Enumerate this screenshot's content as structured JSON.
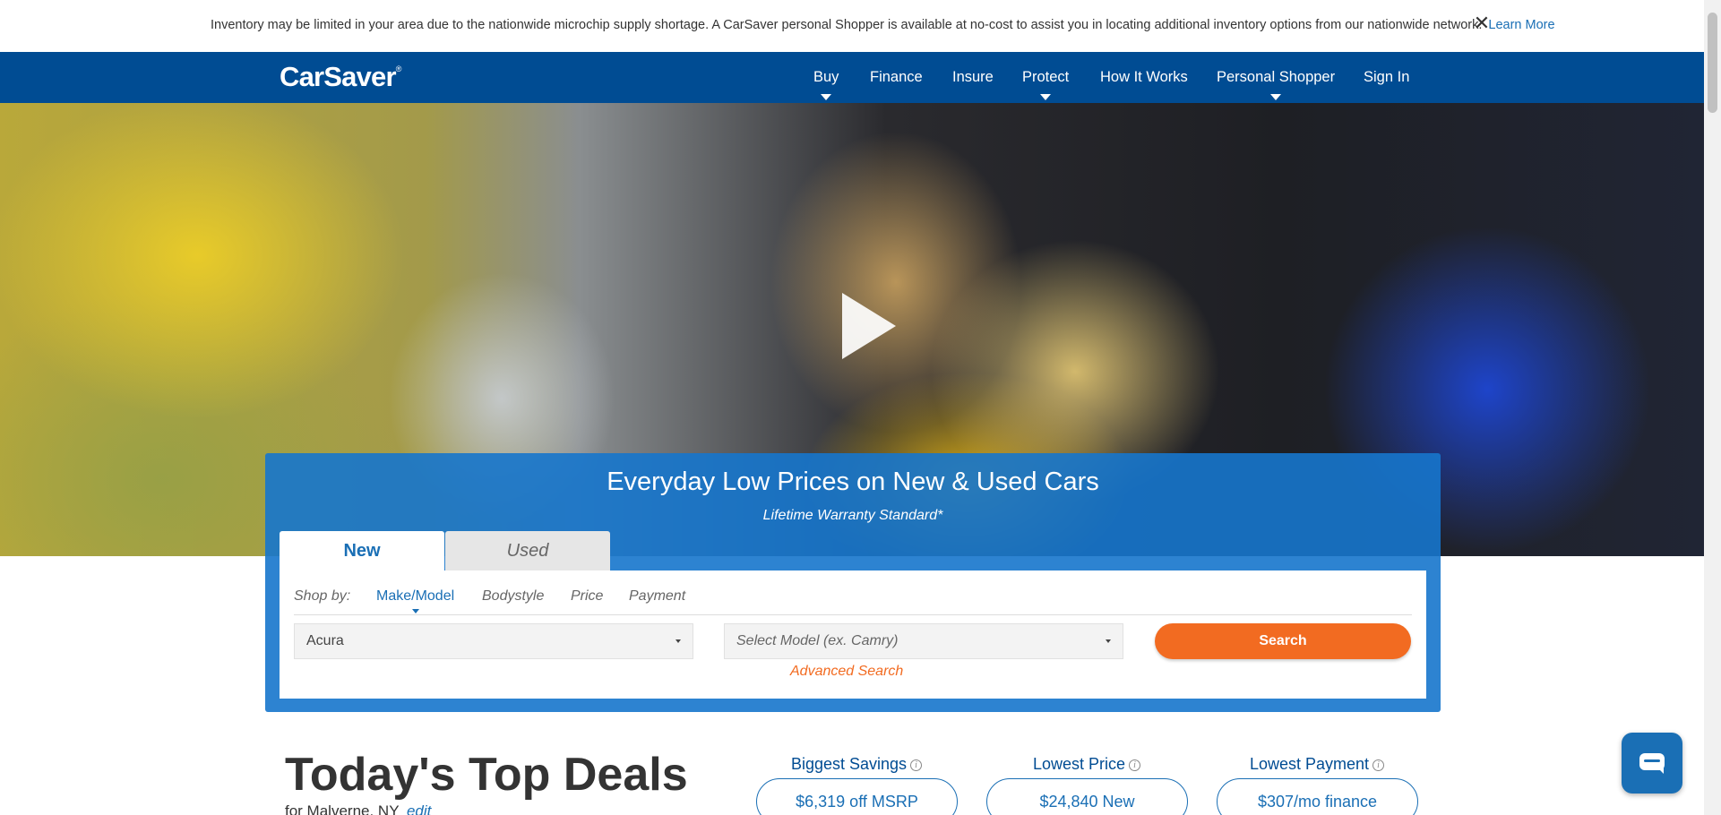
{
  "announcement": {
    "message": "Inventory may be limited in your area due to the nationwide microchip supply shortage. A CarSaver personal Shopper is available at no-cost to assist you in locating additional inventory options from our nationwide network.",
    "link_label": "Learn More",
    "close_label": "✕"
  },
  "navbar": {
    "logo": "CarSaver",
    "logo_mark": "®",
    "items": [
      {
        "label": "Buy",
        "has_dropdown": true
      },
      {
        "label": "Finance",
        "has_dropdown": false
      },
      {
        "label": "Insure",
        "has_dropdown": false
      },
      {
        "label": "Protect",
        "has_dropdown": true
      },
      {
        "label": "How It Works",
        "has_dropdown": false
      },
      {
        "label": "Personal Shopper",
        "has_dropdown": true
      },
      {
        "label": "Sign In",
        "has_dropdown": false
      }
    ]
  },
  "hero": {
    "play_icon": "play-icon"
  },
  "search": {
    "headline": "Everyday Low Prices on New & Used Cars",
    "subhead": "Lifetime Warranty Standard*",
    "tabs": [
      {
        "label": "New",
        "active": true
      },
      {
        "label": "Used",
        "active": false
      }
    ],
    "shop_by_label": "Shop by:",
    "shop_by_options": [
      {
        "label": "Make/Model",
        "active": true
      },
      {
        "label": "Bodystyle",
        "active": false
      },
      {
        "label": "Price",
        "active": false
      },
      {
        "label": "Payment",
        "active": false
      }
    ],
    "make_value": "Acura",
    "model_placeholder": "Select Model (ex. Camry)",
    "search_button": "Search",
    "advanced_search": "Advanced Search"
  },
  "deals": {
    "title": "Today's Top Deals",
    "location_prefix": "for Malverne, NY",
    "edit_label": "edit",
    "info_glyph": "i",
    "cards": [
      {
        "label": "Biggest Savings",
        "value": "$6,319 off MSRP"
      },
      {
        "label": "Lowest Price",
        "value": "$24,840 New"
      },
      {
        "label": "Lowest Payment",
        "value": "$307/mo finance"
      }
    ]
  },
  "colors": {
    "nav_blue": "#004c93",
    "accent_blue": "#1a6fb5",
    "search_orange": "#f26b21"
  }
}
